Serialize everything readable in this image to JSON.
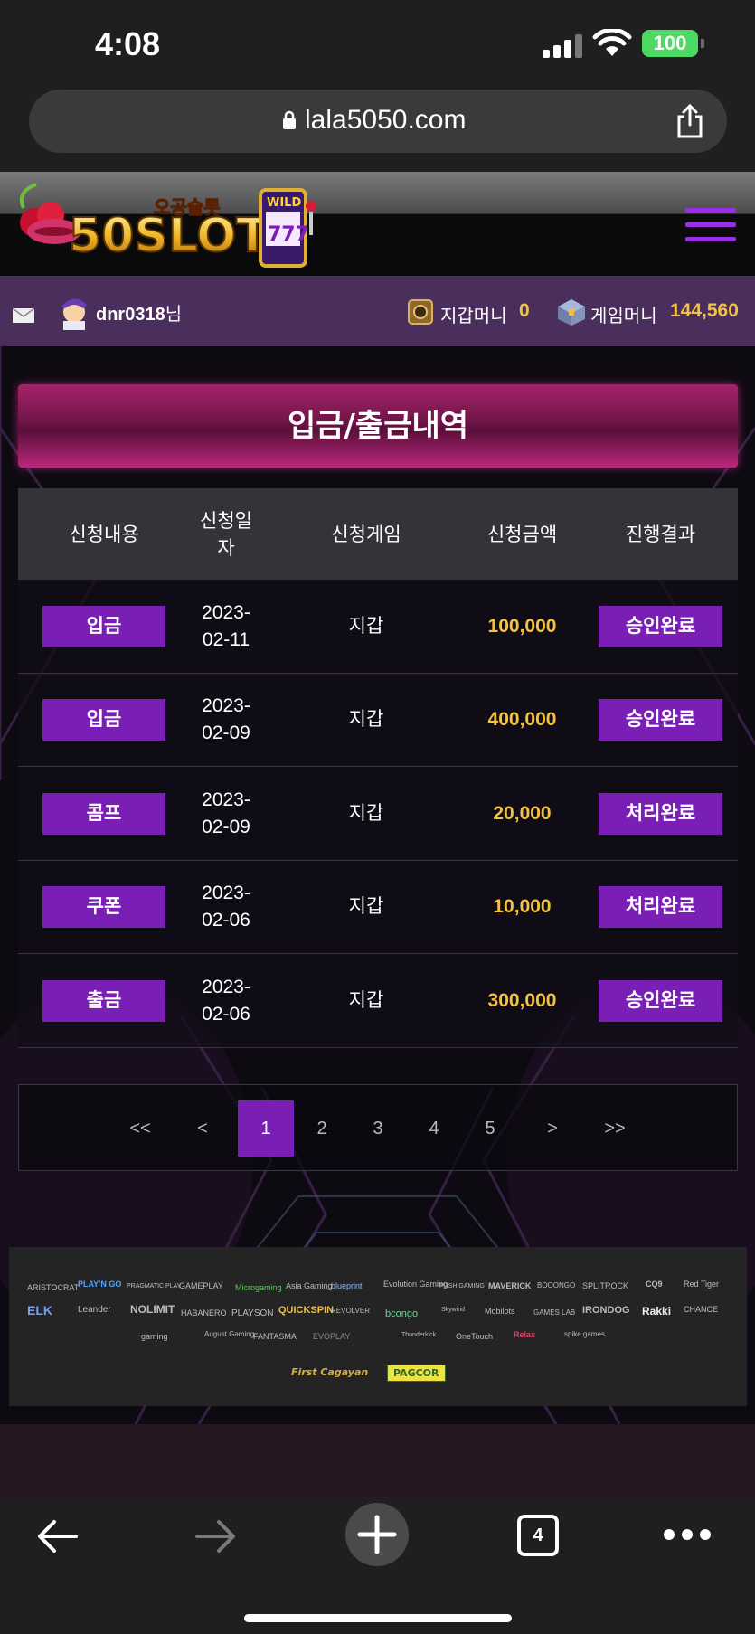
{
  "status_bar": {
    "time": "4:08",
    "battery": "100"
  },
  "browser": {
    "url": "lala5050.com"
  },
  "site": {
    "logo_text": "50SLOT",
    "logo_subtext": "오공슬롯",
    "logo_badge": "WILD"
  },
  "user": {
    "username": "dnr0318",
    "honorific": "님",
    "wallet_label": "지갑머니",
    "wallet_value": "0",
    "game_label": "게임머니",
    "game_value": "144,560"
  },
  "page": {
    "title": "입금/출금내역"
  },
  "table": {
    "headers": [
      "신청내용",
      "신청일자",
      "신청게임",
      "신청금액",
      "진행결과"
    ],
    "rows": [
      {
        "type": "입금",
        "date_y": "2023-",
        "date_md": "02-11",
        "game": "지갑",
        "amount": "100,000",
        "result": "승인완료"
      },
      {
        "type": "입금",
        "date_y": "2023-",
        "date_md": "02-09",
        "game": "지갑",
        "amount": "400,000",
        "result": "승인완료"
      },
      {
        "type": "콤프",
        "date_y": "2023-",
        "date_md": "02-09",
        "game": "지갑",
        "amount": "20,000",
        "result": "처리완료"
      },
      {
        "type": "쿠폰",
        "date_y": "2023-",
        "date_md": "02-06",
        "game": "지갑",
        "amount": "10,000",
        "result": "처리완료"
      },
      {
        "type": "출금",
        "date_y": "2023-",
        "date_md": "02-06",
        "game": "지갑",
        "amount": "300,000",
        "result": "승인완료"
      }
    ]
  },
  "pagination": {
    "first": "<<",
    "prev": "<",
    "pages": [
      "1",
      "2",
      "3",
      "4",
      "5"
    ],
    "current": "1",
    "next": ">",
    "last": ">>"
  },
  "providers": {
    "row1": [
      "ARISTOCRAT",
      "PLAY'N GO",
      "PRAGMATIC PLAY",
      "GAMEPLAY",
      "Microgaming",
      "Asia Gaming",
      "blueprint",
      "Evolution Gaming",
      "PUSH GAMING",
      "MAVERICK",
      "BOOONGO",
      "SPLITROCK",
      "CQ9",
      "Red Tiger"
    ],
    "row2": [
      "ELK",
      "Leander",
      "NOLIMIT",
      "HABANERO",
      "PLAYSON",
      "QUICKSPIN",
      "REVOLVER",
      "bcongo",
      "Skywind",
      "Mobilots",
      "GAMES LAB",
      "IRONDOG",
      "Rakki",
      "CHANCE"
    ],
    "row3": [
      "gaming",
      "August Gaming",
      "FANTASMA",
      "EVOPLAY",
      "Thunderkick",
      "OneTouch",
      "Relax",
      "spike games"
    ],
    "certs": [
      "First Cagayan",
      "PAGCOR"
    ]
  },
  "colors": {
    "accent": "#7a1fb5",
    "gold": "#f2c240",
    "title_pink": "#a7236a",
    "userbar": "#4a2f5c"
  },
  "toolbar": {
    "tab_count": "4"
  }
}
